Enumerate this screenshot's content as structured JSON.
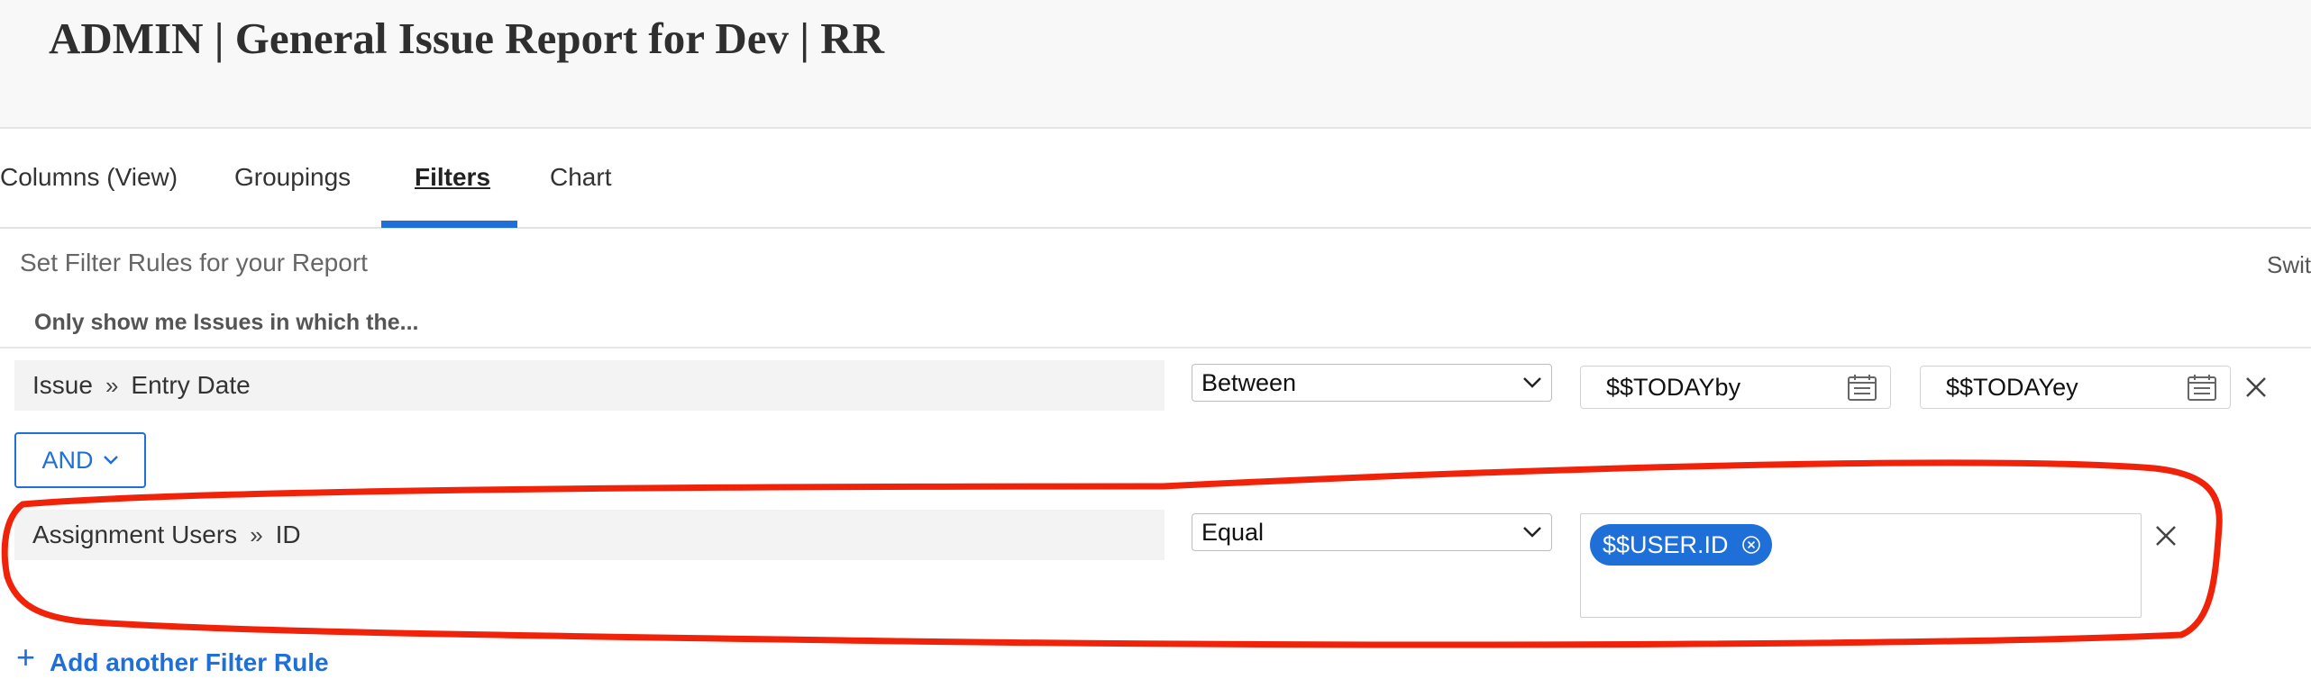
{
  "header": {
    "title": "ADMIN | General Issue Report for Dev | RR"
  },
  "tabs": [
    {
      "label": "Columns (View)"
    },
    {
      "label": "Groupings"
    },
    {
      "label": "Filters",
      "active": true
    },
    {
      "label": "Chart"
    }
  ],
  "filters_panel": {
    "subtitle": "Set Filter Rules for your Report",
    "switch_label": "Swit",
    "lead_text": "Only show me Issues in which the...",
    "rules": [
      {
        "object": "Issue",
        "field": "Entry Date",
        "operator": "Between",
        "value_from": "$$TODAYby",
        "value_to": "$$TODAYey"
      },
      {
        "object": "Assignment Users",
        "field": "ID",
        "operator": "Equal",
        "chips": [
          "$$USER.ID"
        ]
      }
    ],
    "conjunction": "AND",
    "add_rule_label": "Add another Filter Rule"
  },
  "colors": {
    "accent": "#1f6fd8",
    "annotation": "#f0230a",
    "header_bg": "#f8f8f8"
  },
  "icons": {
    "breadcrumb_separator": "double-chevron-right-icon",
    "calendar": "calendar-icon",
    "remove": "close-icon",
    "dropdown": "chevron-down-icon",
    "chip_remove": "circle-x-icon",
    "add": "plus-icon"
  }
}
